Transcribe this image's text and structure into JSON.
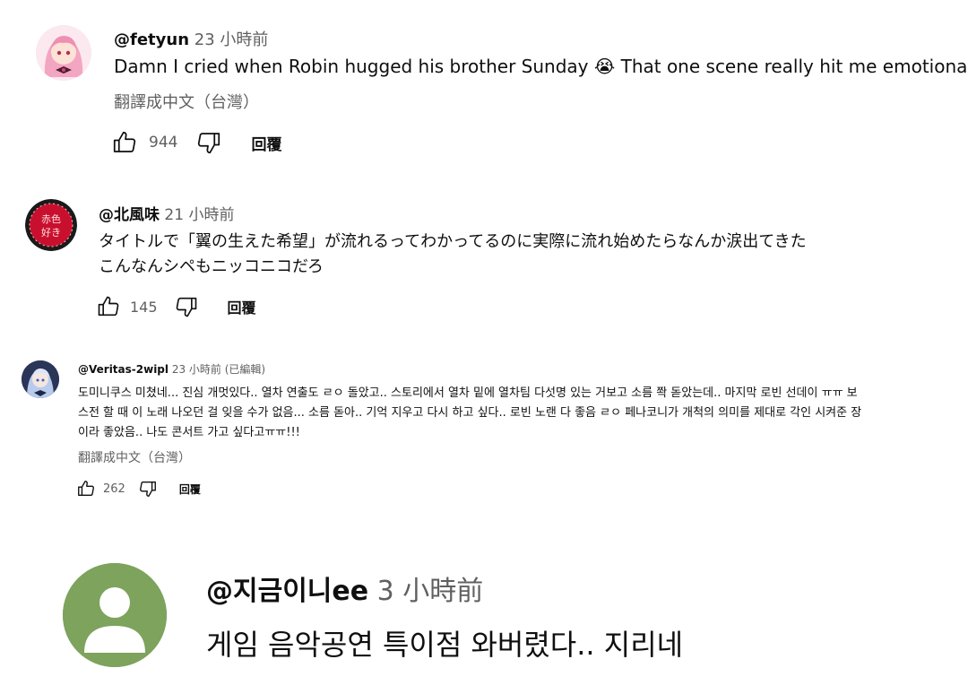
{
  "comments": [
    {
      "handle": "@fetyun",
      "time": "23 小時前",
      "text": "Damn I cried when Robin hugged his brother Sunday 😭 That one scene really hit me emotionally",
      "translate": "翻譯成中文（台灣）",
      "likes": "944",
      "reply": "回覆",
      "avatar_icon": "anime-girl-avatar"
    },
    {
      "handle": "@北風味",
      "time": "21 小時前",
      "lines": [
        "タイトルで「翼の生えた希望」が流れるってわかってるのに実際に流れ始めたらなんか涙出てきた",
        "こんなんシペもニッコニコだろ"
      ],
      "likes": "145",
      "reply": "回覆",
      "avatar_text_top": "赤色",
      "avatar_text_bottom": "好き"
    },
    {
      "handle": "@Veritas-2wipl",
      "time": "23 小時前 (已編輯)",
      "lines": [
        "도미니쿠스 미쳤네... 진심 개멋있다.. 열차 연출도 ㄹㅇ 돌았고.. 스토리에서 열차 밑에 열차팀 다섯명 있는 거보고 소름 쫙 돋았는데.. 마지막 로빈 선데이 ㅠㅠ 보",
        "스전 할 때 이 노래 나오던 걸 잊을 수가 없음... 소름 돋아.. 기억 지우고 다시 하고 싶다.. 로빈 노랜 다 좋음 ㄹㅇ 페나코니가 개척의 의미를 제대로 각인 시켜준 장",
        "이라 좋았음.. 나도 콘서트 가고 싶다고ㅠㅠ!!!"
      ],
      "translate": "翻譯成中文（台灣）",
      "likes": "262",
      "reply": "回覆",
      "avatar_icon": "anime-character-avatar"
    },
    {
      "handle": "@지금이니ee",
      "time": "3 小時前",
      "text": "게임 음악공연 특이점 와버렸다.. 지리네",
      "avatar_icon": "default-user-avatar"
    }
  ],
  "colors": {
    "text": "#0f0f0f",
    "secondary": "#606060",
    "default_avatar": "#7da35c",
    "red_avatar": "#c8102e"
  }
}
